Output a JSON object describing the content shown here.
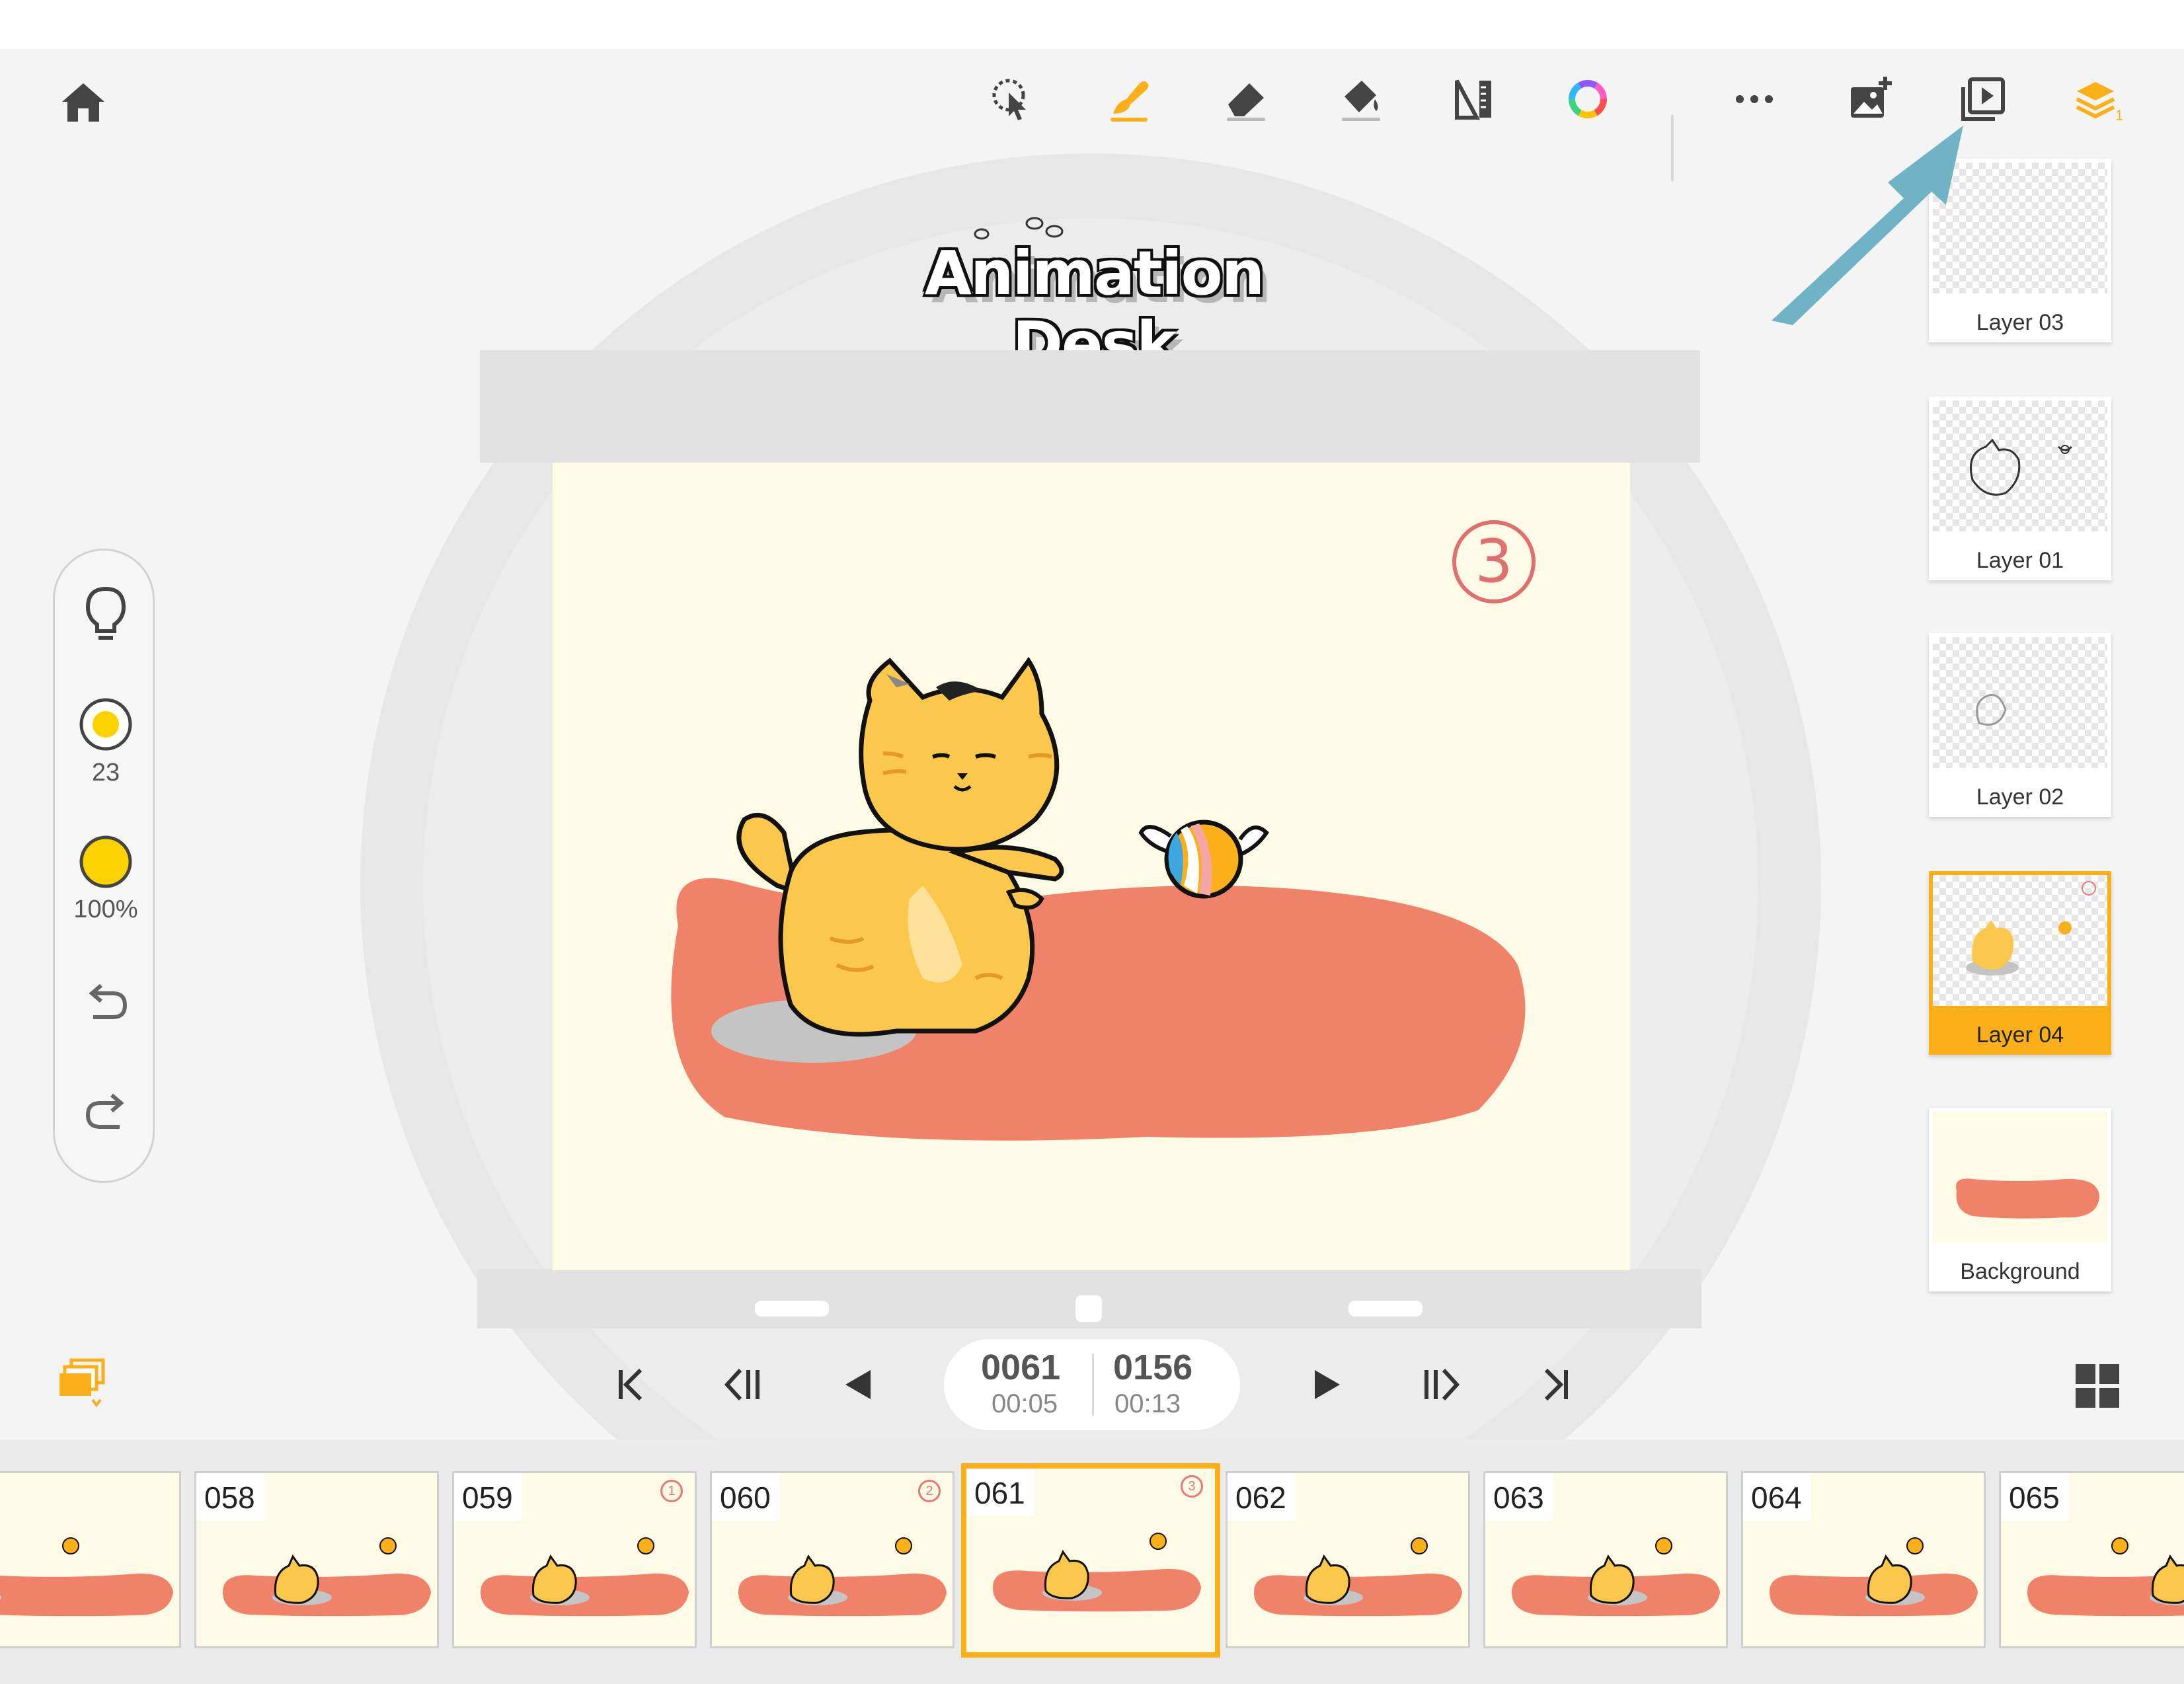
{
  "app": {
    "logo_text": "Animation Desk"
  },
  "toolbar": {
    "icons": [
      "home-icon",
      "lasso-select-icon",
      "brush-icon",
      "eraser-icon",
      "fill-bucket-icon",
      "ruler-icon",
      "color-wheel-icon",
      "more-icon",
      "add-image-icon",
      "play-preview-icon",
      "layers-icon"
    ],
    "layers_count": "1"
  },
  "tool_pill": {
    "brush_size": "23",
    "opacity": "100%",
    "brush_color": "#f9d200"
  },
  "canvas": {
    "frame_mark": "3"
  },
  "layers": [
    {
      "name": "Layer 03"
    },
    {
      "name": "Layer 01"
    },
    {
      "name": "Layer 02"
    },
    {
      "name": "Layer 04",
      "active": true
    },
    {
      "name": "Background"
    }
  ],
  "playback": {
    "current_frame": "0061",
    "current_time": "00:05",
    "total_frames": "0156",
    "total_time": "00:13"
  },
  "timeline": {
    "frames": [
      {
        "num": "",
        "mark": ""
      },
      {
        "num": "058",
        "mark": ""
      },
      {
        "num": "059",
        "mark": "1"
      },
      {
        "num": "060",
        "mark": "2"
      },
      {
        "num": "061",
        "mark": "3",
        "active": true
      },
      {
        "num": "062",
        "mark": ""
      },
      {
        "num": "063",
        "mark": ""
      },
      {
        "num": "064",
        "mark": ""
      },
      {
        "num": "065",
        "mark": ""
      }
    ]
  },
  "colors": {
    "accent": "#fbb019",
    "mat": "#f0826a",
    "canvas_bg": "#fdfbe5",
    "arrow": "#6fb3c4"
  }
}
